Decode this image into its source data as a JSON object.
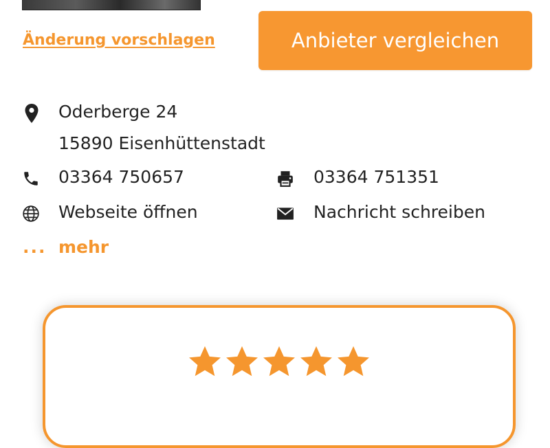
{
  "links": {
    "suggest_change": "Änderung vorschlagen",
    "more_dots": "...",
    "more": "mehr"
  },
  "buttons": {
    "compare": "Anbieter vergleichen"
  },
  "contact": {
    "street": "Oderberge 24",
    "city": "15890 Eisenhüttenstadt",
    "phone": "03364 750657",
    "fax": "03364 751351",
    "website": "Webseite öffnen",
    "message": "Nachricht schreiben"
  },
  "icons": [
    "location-pin-icon",
    "phone-icon",
    "fax-printer-icon",
    "globe-icon",
    "mail-envelope-icon",
    "star-icon"
  ],
  "rating": {
    "stars": 5,
    "max": 5
  },
  "colors": {
    "accent": "#f5962e",
    "button": "#f79731",
    "text": "#222222"
  }
}
